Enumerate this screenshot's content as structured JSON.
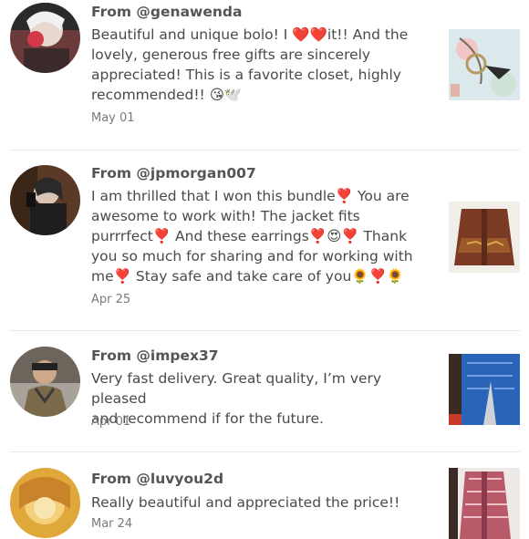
{
  "reviews": [
    {
      "from": "From @genawenda",
      "lines": [
        "Beautiful and unique bolo! I ❤️❤️it!! And the",
        "lovely, generous free gifts are sincerely",
        "appreciated! This is a favorite closet, highly",
        "recommended!! 😘🕊️"
      ],
      "date": "May 01"
    },
    {
      "from": "From @jpmorgan007",
      "lines": [
        "I am thrilled that I won this bundle❣️ You are",
        "awesome to work with! The jacket fits",
        "purrrfect❣️ And these earrings❣️😍❣️ Thank",
        "you so much for sharing and for working with",
        "me❣️ Stay safe and take care of you🌻❣️🌻"
      ],
      "date": "Apr 25"
    },
    {
      "from": "From @impex37",
      "lines": [
        "Very fast delivery. Great quality, I’m very pleased",
        "and recommend if for the future."
      ],
      "date": "Apr 01"
    },
    {
      "from": "From @luvyou2d",
      "lines": [
        "Really beautiful and appreciated the price!!"
      ],
      "date": "Mar 24"
    }
  ]
}
